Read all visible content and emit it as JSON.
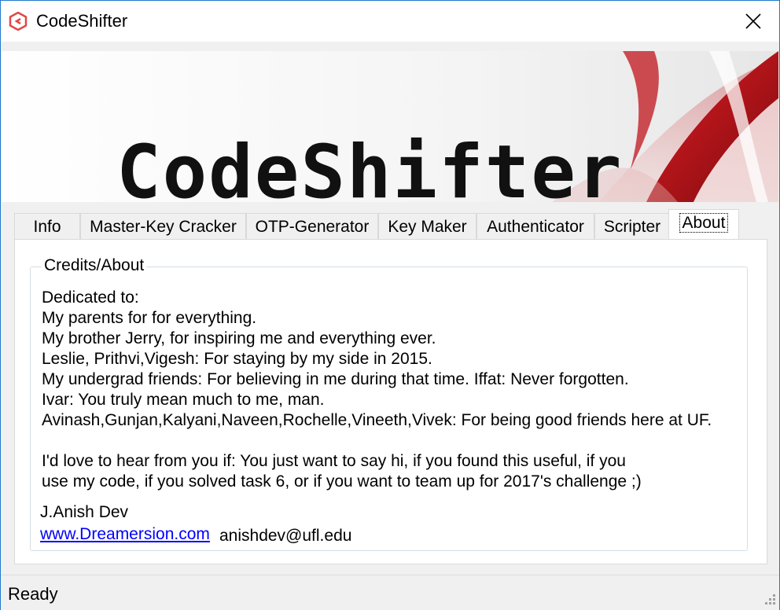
{
  "window": {
    "title": "CodeShifter",
    "close_glyph": "✕"
  },
  "banner": {
    "title": "CodeShifter"
  },
  "tabs": [
    {
      "label": "Info"
    },
    {
      "label": "Master-Key Cracker"
    },
    {
      "label": "OTP-Generator"
    },
    {
      "label": "Key Maker"
    },
    {
      "label": "Authenticator"
    },
    {
      "label": "Scripter"
    },
    {
      "label": "About"
    }
  ],
  "active_tab": "About",
  "about": {
    "group_title": "Credits/About",
    "lines": [
      "Dedicated to:",
      "My parents for for everything.",
      "My brother Jerry, for inspiring me and everything ever.",
      "Leslie, Prithvi,Vigesh: For staying by my side in 2015.",
      "My undergrad friends: For believing in me during that time. Iffat: Never forgotten.",
      "Ivar: You truly mean much to me, man.",
      "Avinash,Gunjan,Kalyani,Naveen,Rochelle,Vineeth,Vivek: For being good friends here at UF."
    ],
    "closing_lines": [
      "I'd love to hear from you if: You just want to say hi, if you found this useful, if you",
      "use my code, if you solved task 6, or if you want to team up for 2017's challenge ;)"
    ],
    "author": "J.Anish Dev",
    "website": "www.Dreamersion.com",
    "email": "anishdev@ufl.edu"
  },
  "status": {
    "text": "Ready"
  },
  "icons": {
    "app": "codeshifter-logo-icon",
    "close": "close-icon",
    "grip": "resize-grip-icon"
  },
  "colors": {
    "window_border": "#1f7acc",
    "link": "#0000ff",
    "banner_red": "#c0141b"
  }
}
